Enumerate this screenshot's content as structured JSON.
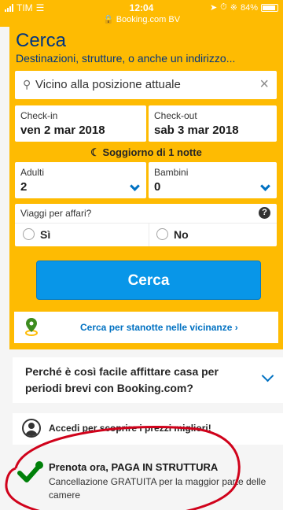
{
  "status_bar": {
    "carrier": "TIM",
    "time": "12:04",
    "url": "Booking.com BV",
    "battery": "84%"
  },
  "search_form": {
    "title": "Cerca",
    "subtitle": "Destinazioni, strutture, o anche un indirizzo...",
    "destination_value": "Vicino alla posizione attuale",
    "checkin_label": "Check-in",
    "checkin_value": "ven 2 mar 2018",
    "checkout_label": "Check-out",
    "checkout_value": "sab 3 mar 2018",
    "nights_text": "Soggiorno di 1 notte",
    "adults_label": "Adulti",
    "adults_value": "2",
    "children_label": "Bambini",
    "children_value": "0",
    "business_label": "Viaggi per affari?",
    "option_yes": "Sì",
    "option_no": "No",
    "search_button": "Cerca",
    "nearby_link": "Cerca per stanotte nelle vicinanze ›"
  },
  "info": {
    "why_text": "Perché è così facile affittare casa per periodi brevi con Booking.com?",
    "login_text": "Accedi per scoprire i prezzi migliori!",
    "book_title": "Prenota ora, PAGA IN STRUTTURA",
    "book_desc": "Cancellazione GRATUITA per la maggior parte delle camere"
  },
  "colors": {
    "brand_yellow": "#febb02",
    "brand_blue": "#003580",
    "button_blue": "#0896e8",
    "link_blue": "#0071c2",
    "check_green": "#008009",
    "annotation_red": "#d0021b"
  }
}
